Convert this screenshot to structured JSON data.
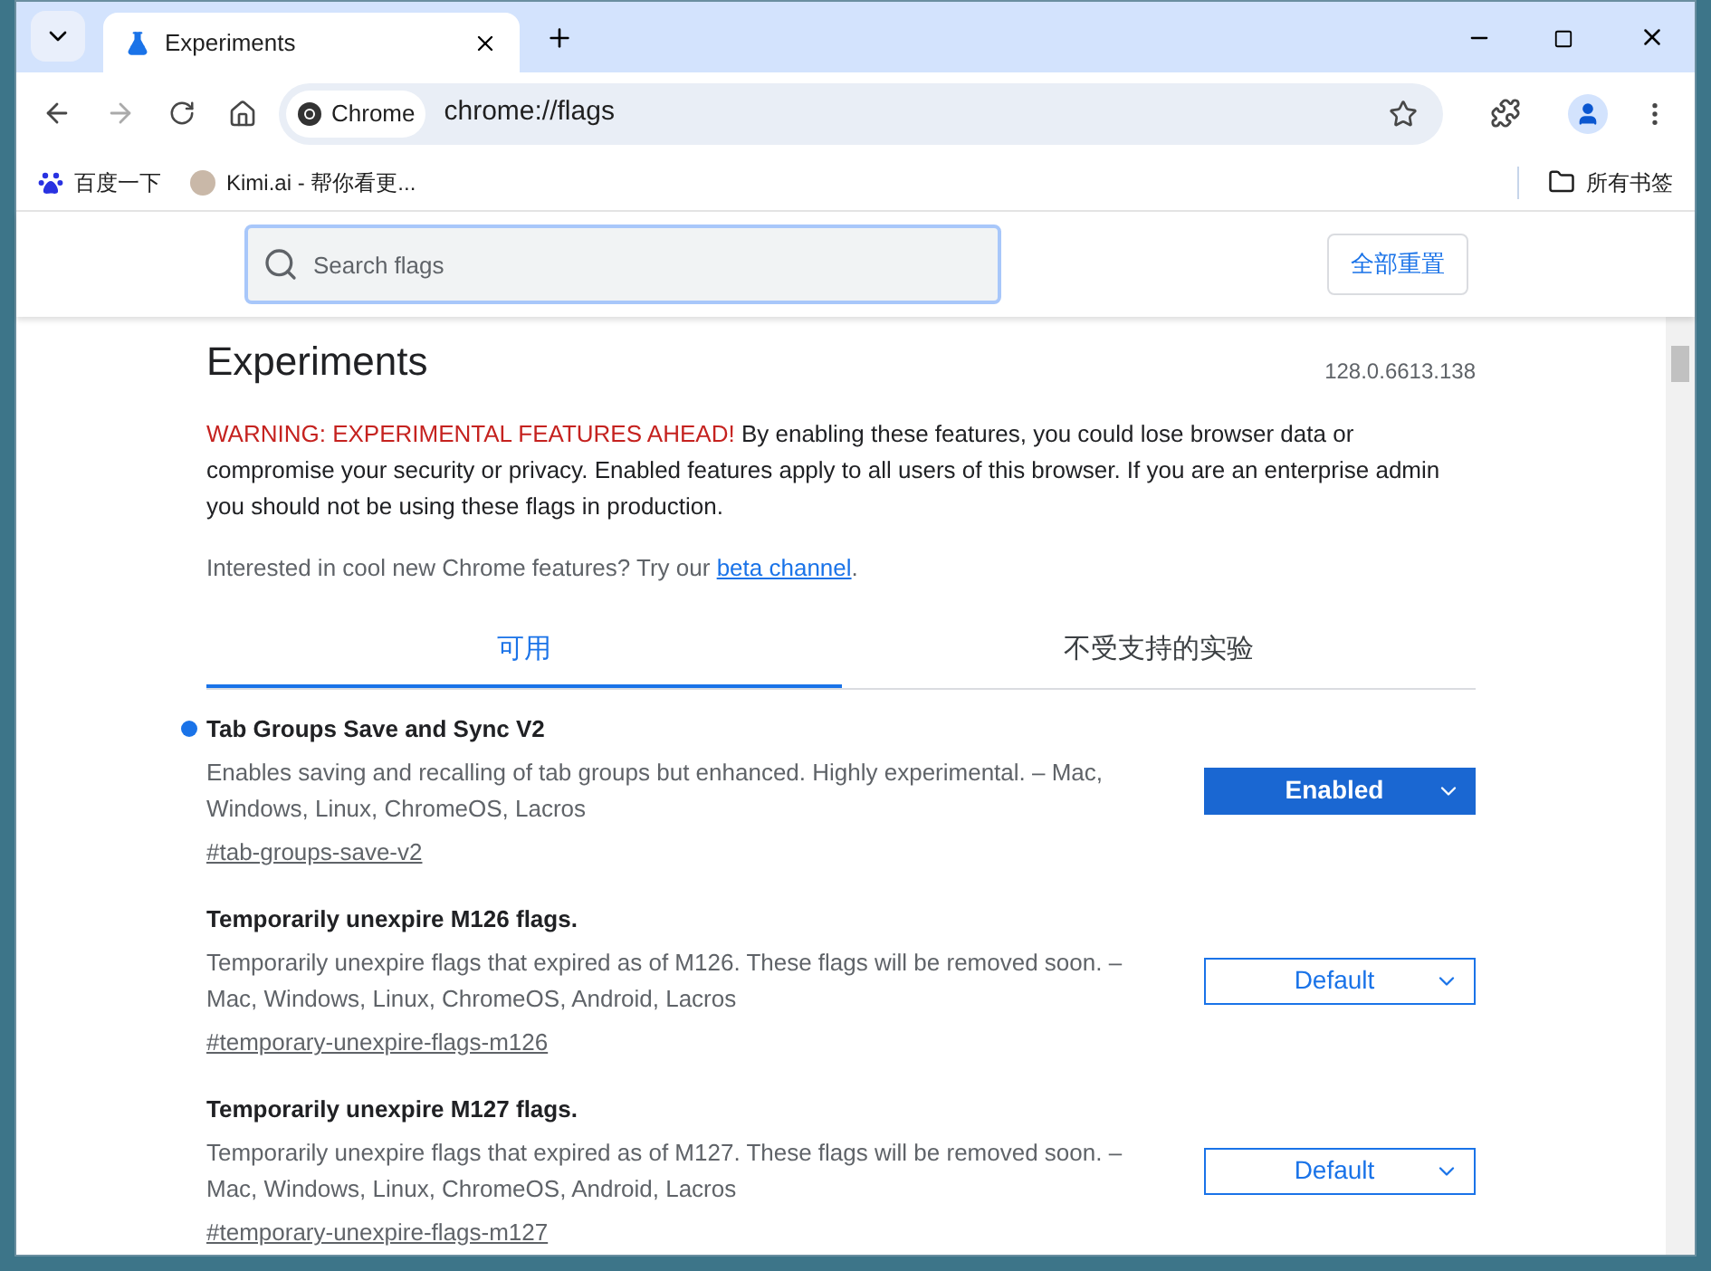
{
  "browser": {
    "tabs": [
      {
        "title": "Experiments",
        "selected": true
      }
    ],
    "omnibox": {
      "chip": "Chrome",
      "url": "chrome://flags"
    },
    "bookmarks": [
      {
        "label": "百度一下",
        "kind": "baidu"
      },
      {
        "label": "Kimi.ai - 帮你看更...",
        "kind": "avatar"
      }
    ],
    "all_bookmarks": "所有书签"
  },
  "header": {
    "search": {
      "placeholder": "Search flags"
    },
    "reset": "全部重置"
  },
  "page": {
    "title": "Experiments",
    "version": "128.0.6613.138",
    "warning": {
      "label": "WARNING: EXPERIMENTAL FEATURES AHEAD!",
      "text": "By enabling these features, you could lose browser data or compromise your security or privacy. Enabled features apply to all users of this browser. If you are an enterprise admin you should not be using these flags in production."
    },
    "intro": {
      "text": "Interested in cool new Chrome features? Try our",
      "link": "beta channel",
      "end": "."
    },
    "tabs": [
      {
        "label": "可用",
        "selected": true
      },
      {
        "label": "不受支持的实验",
        "selected": false
      }
    ],
    "flags": [
      {
        "name": "Tab Groups Save and Sync V2",
        "description": "Enables saving and recalling of tab groups but enhanced. Highly experimental. – Mac, Windows, Linux, ChromeOS, Lacros",
        "link": "#tab-groups-save-v2",
        "value": "Enabled",
        "modified": true
      },
      {
        "name": "Temporarily unexpire M126 flags.",
        "description": "Temporarily unexpire flags that expired as of M126. These flags will be removed soon. – Mac, Windows, Linux, ChromeOS, Android, Lacros",
        "link": "#temporary-unexpire-flags-m126",
        "value": "Default",
        "modified": false
      },
      {
        "name": "Temporarily unexpire M127 flags.",
        "description": "Temporarily unexpire flags that expired as of M127. These flags will be removed soon. – Mac, Windows, Linux, ChromeOS, Android, Lacros",
        "link": "#temporary-unexpire-flags-m127",
        "value": "Default",
        "modified": false
      }
    ]
  }
}
